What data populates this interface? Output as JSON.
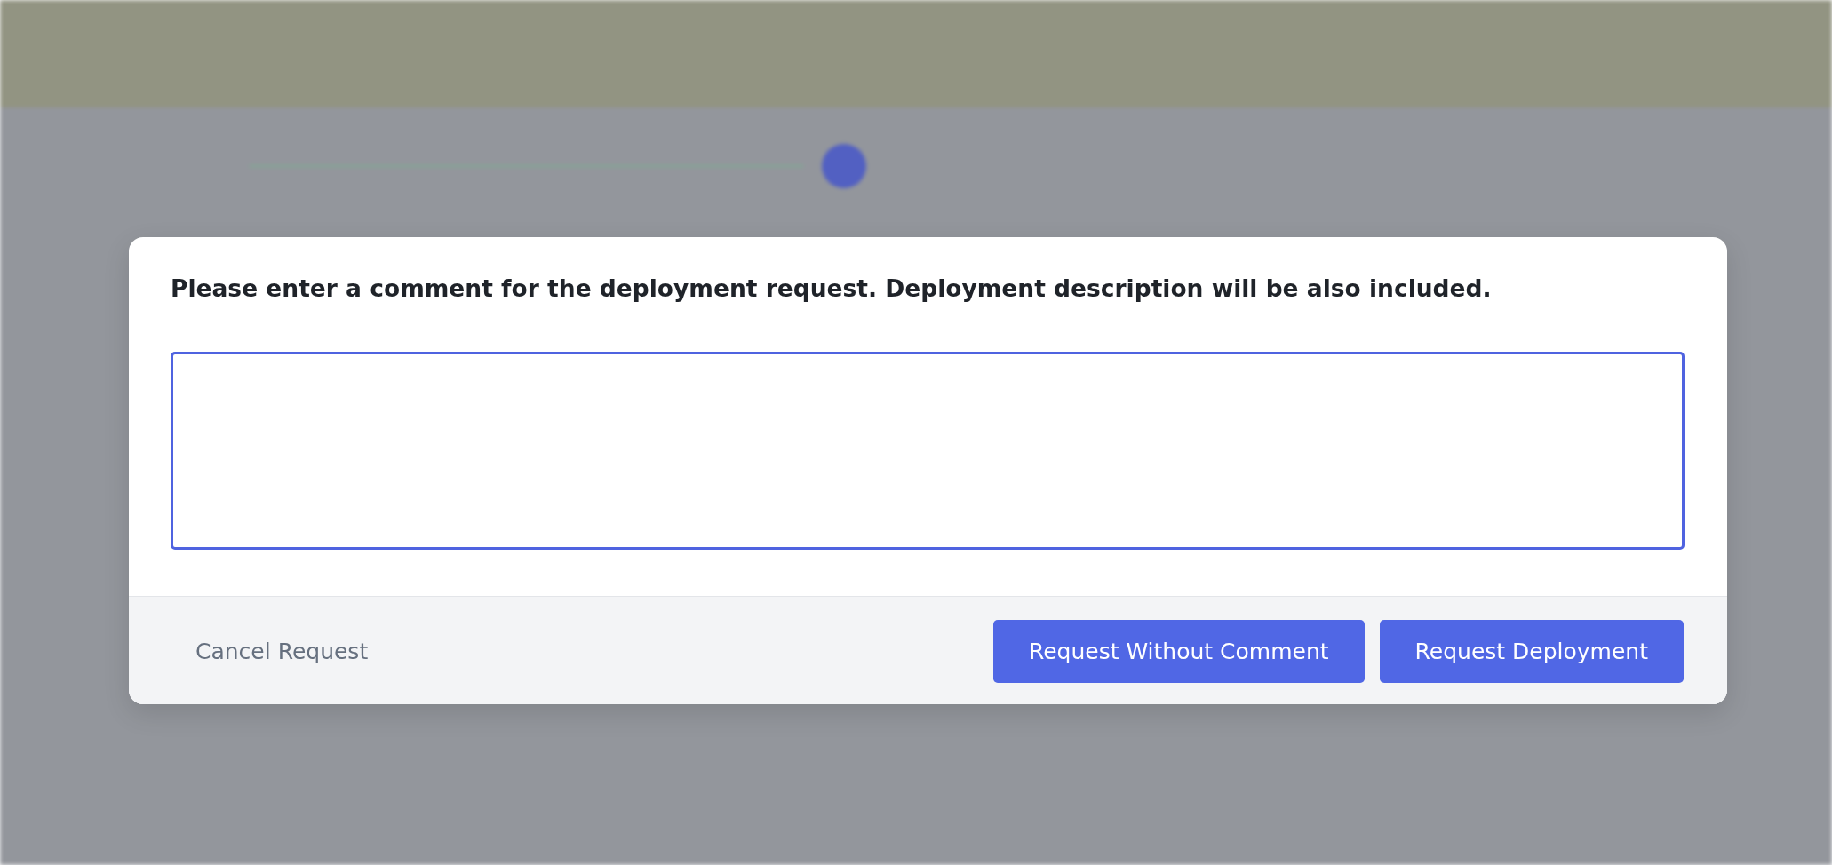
{
  "dialog": {
    "message": "Please enter a comment for the deployment request. Deployment description will be also included.",
    "comment_field": {
      "focused": true
    },
    "actions": [
      {
        "label": "Cancel Request",
        "kind": "link"
      },
      {
        "label": "Request Without Comment",
        "kind": "primary"
      },
      {
        "label": "Request Deployment",
        "kind": "primary"
      }
    ]
  }
}
